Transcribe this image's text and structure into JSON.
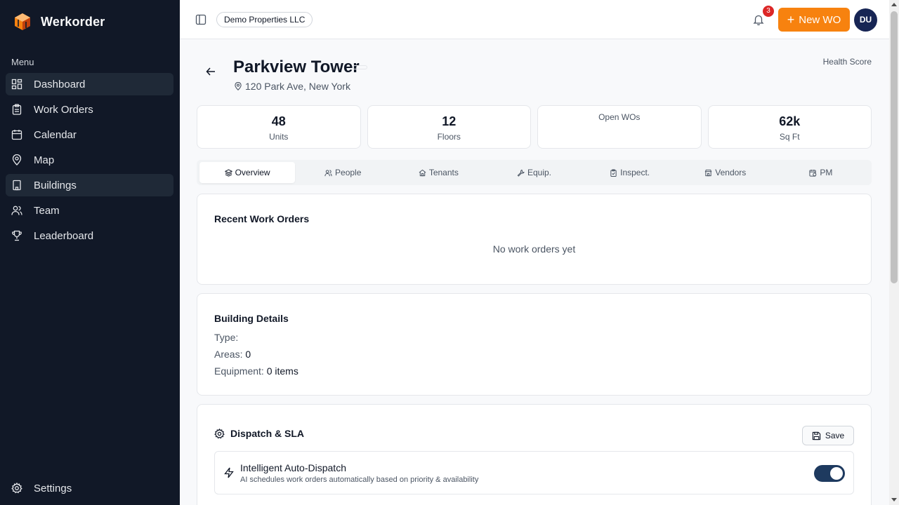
{
  "brand": {
    "name": "Werkorder",
    "accent": "#f7820f"
  },
  "sidebar": {
    "menu_label": "Menu",
    "items": [
      {
        "label": "Dashboard",
        "icon": "grid-icon",
        "active": true
      },
      {
        "label": "Work Orders",
        "icon": "clipboard-icon",
        "active": false
      },
      {
        "label": "Calendar",
        "icon": "calendar-icon",
        "active": false
      },
      {
        "label": "Map",
        "icon": "map-pin-icon",
        "active": false
      },
      {
        "label": "Buildings",
        "icon": "building-icon",
        "active": true
      },
      {
        "label": "Team",
        "icon": "users-icon",
        "active": false
      },
      {
        "label": "Leaderboard",
        "icon": "trophy-icon",
        "active": false
      }
    ],
    "settings_label": "Settings"
  },
  "header": {
    "org": "Demo Properties LLC",
    "notifications_count": "3",
    "new_wo_label": "New WO",
    "avatar_initials": "DU"
  },
  "building": {
    "title": "Parkview Tower",
    "address": "120 Park Ave, New York",
    "health_label": "Health Score"
  },
  "stats": [
    {
      "value": "48",
      "label": "Units"
    },
    {
      "value": "12",
      "label": "Floors"
    },
    {
      "value": "",
      "label": "Open WOs"
    },
    {
      "value": "62k",
      "label": "Sq Ft"
    }
  ],
  "tabs": [
    {
      "label": "Overview",
      "icon": "layers-icon"
    },
    {
      "label": "People",
      "icon": "users-icon"
    },
    {
      "label": "Tenants",
      "icon": "home-icon"
    },
    {
      "label": "Equip.",
      "icon": "wrench-icon"
    },
    {
      "label": "Inspect.",
      "icon": "clipboard-check-icon"
    },
    {
      "label": "Vendors",
      "icon": "store-icon"
    },
    {
      "label": "PM",
      "icon": "calendar-clock-icon"
    }
  ],
  "recent": {
    "title": "Recent Work Orders",
    "empty": "No work orders yet"
  },
  "details": {
    "title": "Building Details",
    "type_key": "Type:",
    "type_value": "",
    "areas_key": "Areas:",
    "areas_value": "0",
    "equipment_key": "Equipment:",
    "equipment_value": "0 items"
  },
  "dispatch": {
    "title": "Dispatch & SLA",
    "save_label": "Save",
    "auto_title": "Intelligent Auto-Dispatch",
    "auto_desc": "AI schedules work orders automatically based on priority & availability",
    "auto_enabled": true
  }
}
